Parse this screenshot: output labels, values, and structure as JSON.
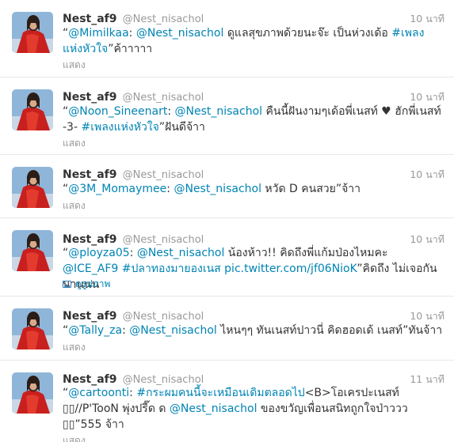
{
  "tweets": [
    {
      "name": "Nest_af9",
      "handle": "@Nest_nisachol",
      "time": "10 นาที",
      "text": [
        "“",
        {
          "link": "@Mimilkaa"
        },
        ": ",
        {
          "link": "@Nest_nisachol"
        },
        " ดูแลสุขภาพด้วยนะจ๊ะ เป็นห่วงเด้อ ",
        {
          "link": "#เพลงแห่งหัวใจ"
        },
        "”ค้าาาาา"
      ],
      "action": "แสดง",
      "action_type": "expand"
    },
    {
      "name": "Nest_af9",
      "handle": "@Nest_nisachol",
      "time": "10 นาที",
      "text": [
        "“",
        {
          "link": "@Noon_Sineenart"
        },
        ": ",
        {
          "link": "@Nest_nisachol"
        },
        " คืนนี้ฝันงามๆเด้อพี่เนสท์ ♥ ฮักพี่เนสท์ -3- ",
        {
          "link": "#เพลงแห่งหัวใจ"
        },
        "”ฝันดีจ้าา"
      ],
      "action": "แสดง",
      "action_type": "expand"
    },
    {
      "name": "Nest_af9",
      "handle": "@Nest_nisachol",
      "time": "10 นาที",
      "text": [
        "“",
        {
          "link": "@3M_Momaymee"
        },
        ": ",
        {
          "link": "@Nest_nisachol"
        },
        " หวัด D คนสวย”จ้าา"
      ],
      "action": "แสดง",
      "action_type": "expand"
    },
    {
      "name": "Nest_af9",
      "handle": "@Nest_nisachol",
      "time": "10 นาที",
      "text": [
        "“",
        {
          "link": "@ployza05"
        },
        ": ",
        {
          "link": "@Nest_nisachol"
        },
        " น้องห้าว!! คิดถึงพี่แก้มป่องไหมคะ ",
        {
          "link": "@ICE_AF9"
        },
        " ",
        {
          "link": "#ปลาทองมายองเนส"
        },
        " ",
        {
          "link": "pic.twitter.com/jf06NioK"
        },
        "”คิดถึง ไม่เจอกันนานนน"
      ],
      "action": "ดูรูปภาพ",
      "action_type": "media",
      "action_icon": "photo-icon"
    },
    {
      "name": "Nest_af9",
      "handle": "@Nest_nisachol",
      "time": "10 นาที",
      "text": [
        "“",
        {
          "link": "@Tally_za"
        },
        ": ",
        {
          "link": "@Nest_nisachol"
        },
        " ไหนๆๆ ทันเนสท์ปาวนี่ คิดฮอดเด้ เนสท์”ทันจ้าา"
      ],
      "action": "แสดง",
      "action_type": "expand"
    },
    {
      "name": "Nest_af9",
      "handle": "@Nest_nisachol",
      "time": "11 นาที",
      "text": [
        "“",
        {
          "link": "@cartoonti"
        },
        ": ",
        {
          "link": "#กระผมคนนี้จะเหมือนเดิมตลอดไป"
        },
        "<B>โอเครปะเนสท์ ▯▯//P'TooN พุ่งปรี๊ด ด ",
        {
          "link": "@Nest_nisachol"
        },
        " ของขวัญเพื่อนสนิทถูกใจป่าววว ▯▯”555 จ้าา"
      ],
      "action": "แสดง",
      "action_type": "expand"
    }
  ],
  "colors": {
    "link": "#0084b4",
    "muted": "#999999",
    "text": "#333333",
    "separator": "#e8e8e8"
  }
}
